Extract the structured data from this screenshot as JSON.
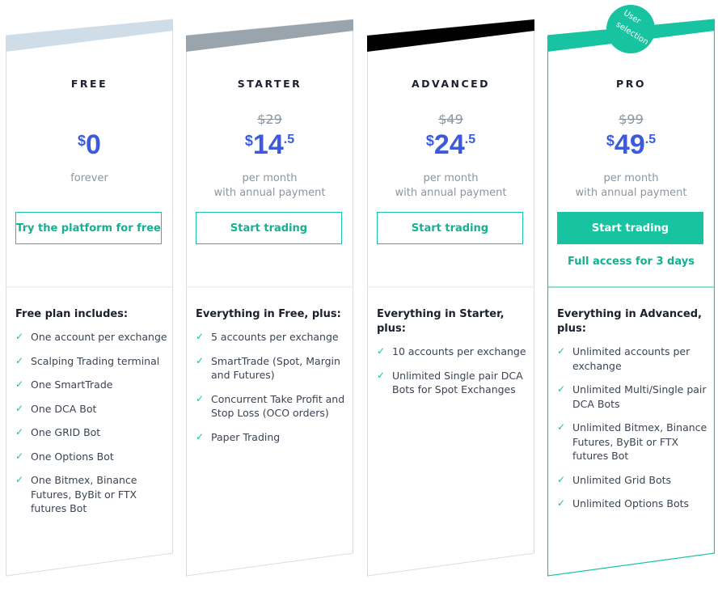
{
  "badge": {
    "line1": "User",
    "line2": "selection"
  },
  "plans": [
    {
      "name": "FREE",
      "old_price": "",
      "currency": "$",
      "price_int": "0",
      "price_frac": "",
      "period_line1": "forever",
      "period_line2": "",
      "cta_label": "Try the platform for free",
      "trial_note": "",
      "features_heading": "Free plan includes:",
      "features": [
        "One account per exchange",
        "Scalping Trading terminal",
        "One SmartTrade",
        "One DCA Bot",
        "One GRID Bot",
        "One Options Bot",
        "One Bitmex, Binance Futures, ByBit or FTX futures Bot"
      ]
    },
    {
      "name": "STARTER",
      "old_price": "$29",
      "currency": "$",
      "price_int": "14",
      "price_frac": ".5",
      "period_line1": "per month",
      "period_line2": "with annual payment",
      "cta_label": "Start trading",
      "trial_note": "",
      "features_heading": "Everything in Free, plus:",
      "features": [
        "5 accounts per exchange",
        "SmartTrade (Spot, Margin and Futures)",
        "Concurrent Take Profit and Stop Loss (OCO orders)",
        "Paper Trading"
      ]
    },
    {
      "name": "ADVANCED",
      "old_price": "$49",
      "currency": "$",
      "price_int": "24",
      "price_frac": ".5",
      "period_line1": "per month",
      "period_line2": "with annual payment",
      "cta_label": "Start trading",
      "trial_note": "",
      "features_heading": "Everything in Starter, plus:",
      "features": [
        "10 accounts per exchange",
        "Unlimited Single pair DCA Bots for Spot Exchanges"
      ]
    },
    {
      "name": "PRO",
      "old_price": "$99",
      "currency": "$",
      "price_int": "49",
      "price_frac": ".5",
      "period_line1": "per month",
      "period_line2": "with annual payment",
      "cta_label": "Start trading",
      "trial_note": "Full access for 3 days",
      "features_heading": "Everything in Advanced, plus:",
      "features": [
        "Unlimited accounts per exchange",
        "Unlimited Multi/Single pair DCA Bots",
        "Unlimited Bitmex, Binance Futures, ByBit or FTX futures Bot",
        "Unlimited Grid Bots",
        "Unlimited Options Bots"
      ]
    }
  ],
  "colors": {
    "free_top": "#cfdde8",
    "starter_top": "#9aa4ad",
    "advanced_top": "#000000",
    "pro_top": "#18c3a1",
    "accent": "#18c3a1",
    "price": "#3b5bdb"
  },
  "icons": {
    "check": "check-icon"
  }
}
